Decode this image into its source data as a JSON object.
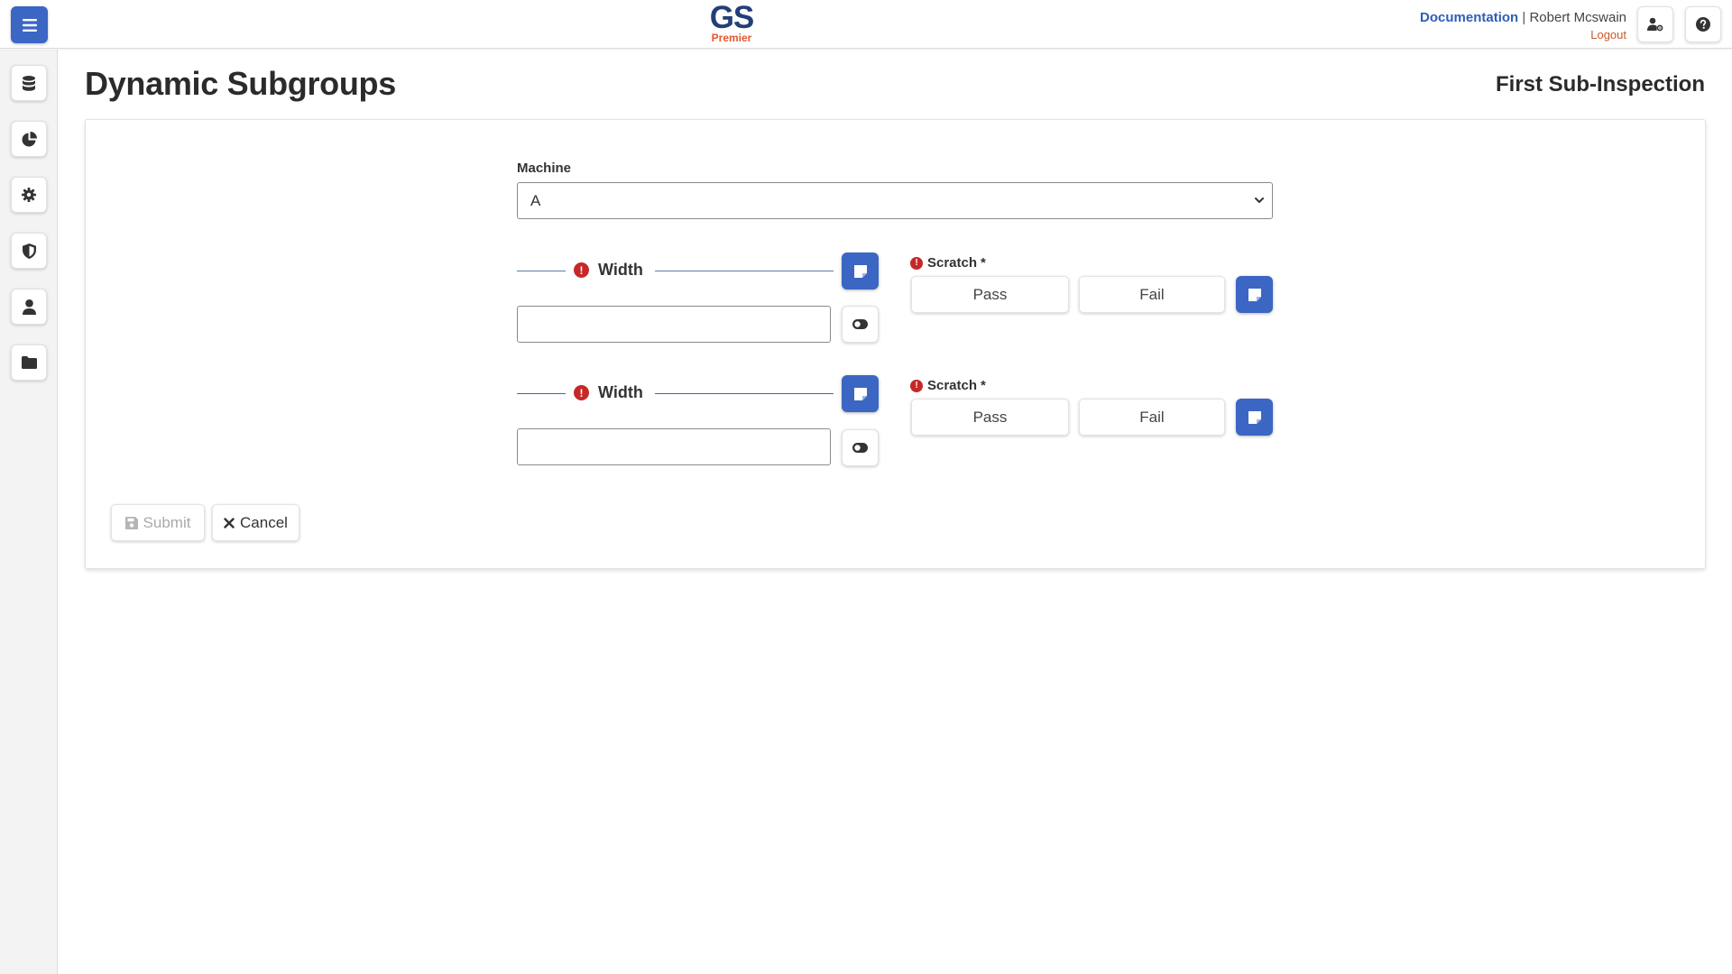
{
  "header": {
    "logo_main": "GS",
    "logo_sub": "Premier",
    "documentation_label": "Documentation",
    "separator": "|",
    "user_name": "Robert Mcswain",
    "logout_label": "Logout"
  },
  "page": {
    "title": "Dynamic Subgroups",
    "subtitle": "First Sub-Inspection"
  },
  "form": {
    "machine_label": "Machine",
    "machine_value": "A",
    "subgroups": [
      {
        "width_label": "Width",
        "width_value": "",
        "scratch_label": "Scratch",
        "required_mark": "*",
        "pass_label": "Pass",
        "fail_label": "Fail"
      },
      {
        "width_label": "Width",
        "width_value": "",
        "scratch_label": "Scratch",
        "required_mark": "*",
        "pass_label": "Pass",
        "fail_label": "Fail"
      }
    ],
    "submit_label": "Submit",
    "cancel_label": "Cancel"
  },
  "colors": {
    "primary": "#3b66c3",
    "error": "#c62828",
    "logo_dark": "#233f7a",
    "logo_accent": "#e4572e",
    "link": "#2e5fb5"
  },
  "icons": {
    "menu": "hamburger-icon",
    "user_settings": "user-cog-icon",
    "help": "question-circle-icon",
    "sidebar": [
      "database-icon",
      "pie-chart-icon",
      "gear-icon",
      "shield-icon",
      "user-icon",
      "folder-icon"
    ],
    "note": "sticky-note-icon",
    "toggle": "toggle-icon",
    "error": "exclamation-circle-icon",
    "submit": "save-icon",
    "cancel": "times-icon"
  }
}
